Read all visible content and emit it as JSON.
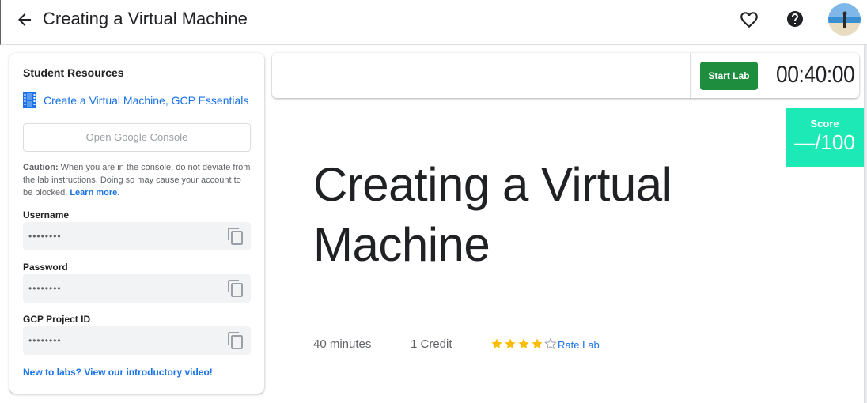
{
  "header": {
    "title": "Creating a Virtual Machine",
    "icons": [
      "arrow-back-icon",
      "heart-icon",
      "help-icon",
      "avatar"
    ]
  },
  "sidebar": {
    "title": "Student Resources",
    "resource_link": "Create a Virtual Machine, GCP Essentials",
    "console_button": "Open Google Console",
    "caution_label": "Caution:",
    "caution_text": " When you are in the console, do not deviate from the lab instructions. Doing so may cause your account to be blocked. ",
    "learn_more": "Learn more.",
    "fields": [
      {
        "label": "Username",
        "value": "••••••••"
      },
      {
        "label": "Password",
        "value": "••••••••"
      },
      {
        "label": "GCP Project ID",
        "value": "••••••••"
      }
    ],
    "intro_link": "New to labs? View our introductory video!"
  },
  "topbar": {
    "start_label": "Start Lab",
    "timer": "00:40:00"
  },
  "score": {
    "label": "Score",
    "value": "—/100"
  },
  "lab": {
    "title": "Creating a Virtual Machine",
    "duration": "40 minutes",
    "credits": "1 Credit",
    "rating": 4,
    "rating_max": 5,
    "rate_label": "Rate Lab"
  },
  "colors": {
    "accent": "#1a73e8",
    "start_button": "#1e8e3e",
    "score_bg": "#1de9b6",
    "star": "#fbbc04"
  }
}
